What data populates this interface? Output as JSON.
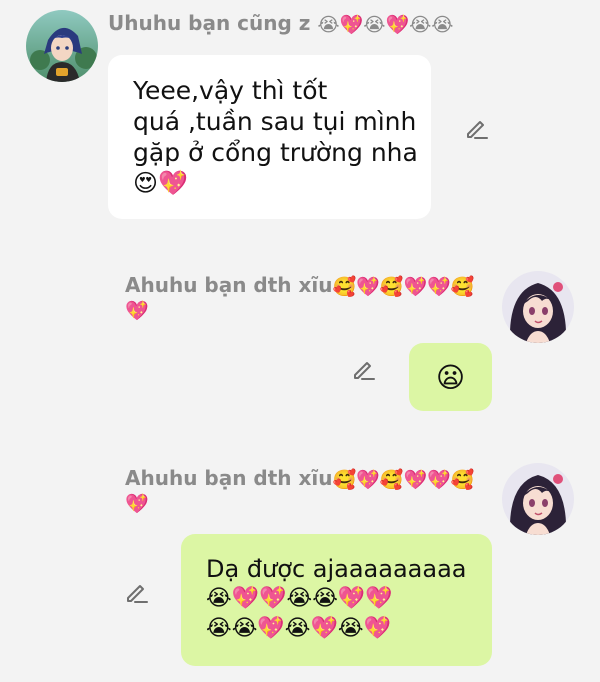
{
  "messages": [
    {
      "direction": "incoming",
      "sender_name": "Uhuhu bạn cũng z",
      "sender_emojis": "😭💖😭💖😭😭",
      "text_lines": [
        "Yeee,vậy thì tốt",
        "quá ,tuần sau tụi mình",
        "gặp ở cổng trường nha"
      ],
      "emoji_line": "😍💖"
    },
    {
      "direction": "outgoing",
      "sender_name": "Ahuhu bạn dth xĩu",
      "sender_emojis_1": "🥰💖🥰💖💖🥰",
      "sender_emojis_2": "💖",
      "emoji_only": "😦"
    },
    {
      "direction": "outgoing",
      "sender_name": "Ahuhu bạn dth xĩu",
      "sender_emojis_1": "🥰💖🥰💖💖🥰",
      "sender_emojis_2": "💖",
      "text_lines": [
        "Dạ được ajaaaaaaaaa"
      ],
      "emoji_lines": [
        "😭💖💖😭😭💖💖",
        "😭😭💖😭💖😭💖"
      ]
    }
  ],
  "icons": {
    "edit": "pencil-icon",
    "avatar_incoming": "avatar-blue-haired-character",
    "avatar_outgoing": "avatar-dark-haired-girl"
  },
  "colors": {
    "background": "#f3f3f3",
    "incoming_bubble": "#ffffff",
    "outgoing_bubble": "#dcf6a4",
    "sender_name": "#8a8a8a",
    "icon_gray": "#6f6f6f"
  }
}
